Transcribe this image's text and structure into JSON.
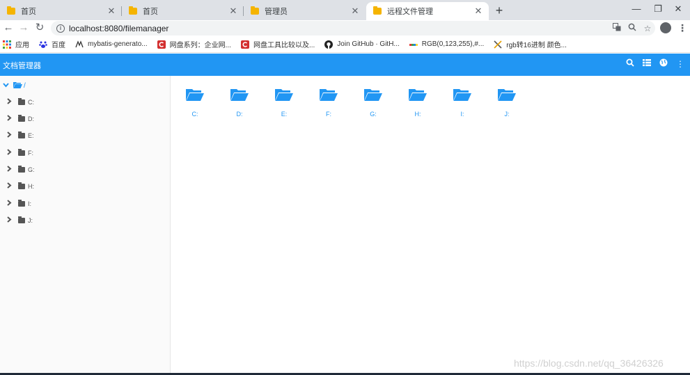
{
  "browser": {
    "tabs": [
      {
        "title": "首页",
        "active": false
      },
      {
        "title": "首页",
        "active": false
      },
      {
        "title": "管理员",
        "active": false
      },
      {
        "title": "远程文件管理",
        "active": true
      }
    ],
    "new_tab": "+",
    "window_controls": {
      "minimize": "—",
      "restore": "❐",
      "close": "✕"
    },
    "nav": {
      "back": "←",
      "forward": "→",
      "reload": "↻"
    },
    "url": "localhost:8080/filemanager",
    "bookmarks": [
      {
        "label": "应用",
        "icon": "apps-grid-icon"
      },
      {
        "label": "百度",
        "icon": "baidu-paw-icon"
      },
      {
        "label": "mybatis-generato...",
        "icon": "mybatis-icon"
      },
      {
        "label": "网盘系列：企业网...",
        "icon": "red-c-icon"
      },
      {
        "label": "网盘工具比较以及...",
        "icon": "red-c-icon"
      },
      {
        "label": "Join GitHub · GitH...",
        "icon": "github-icon"
      },
      {
        "label": "RGB(0,123,255),#...",
        "icon": "rgb-icon"
      },
      {
        "label": "rgb转16进制 颜色...",
        "icon": "tools-icon"
      }
    ]
  },
  "app": {
    "title": "文档管理器",
    "header_icons": [
      "search-icon",
      "list-view-icon",
      "globe-icon",
      "more-vertical-icon"
    ],
    "accent_color": "#2196f3"
  },
  "tree": {
    "root_label": "/",
    "drives": [
      "C:",
      "D:",
      "E:",
      "F:",
      "G:",
      "H:",
      "I:",
      "J:"
    ]
  },
  "content": {
    "drives": [
      "C:",
      "D:",
      "E:",
      "F:",
      "G:",
      "H:",
      "I:",
      "J:"
    ]
  },
  "watermark": "https://blog.csdn.net/qq_36426326"
}
